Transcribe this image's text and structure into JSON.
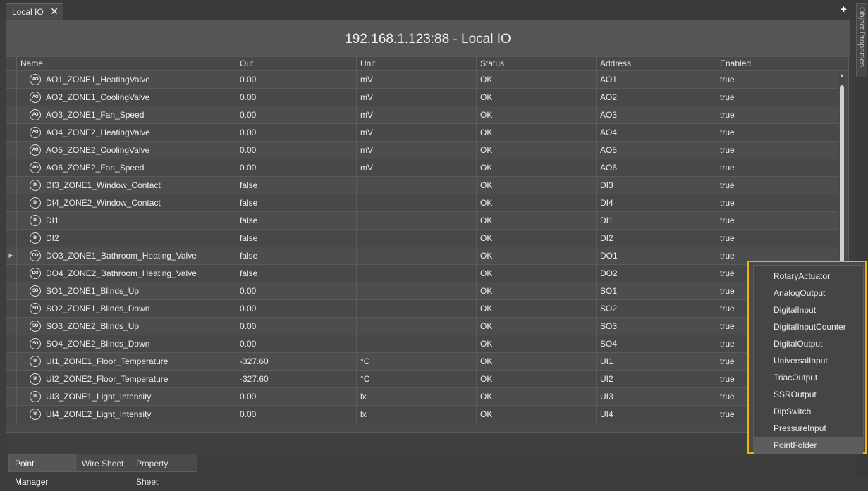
{
  "tabs": {
    "document_tab": "Local IO",
    "close_glyph": "✕",
    "add_glyph": "+"
  },
  "side_panel": {
    "label": "Object Properties"
  },
  "page_title": "192.168.1.123:88 - Local IO",
  "columns": [
    "Name",
    "Out",
    "Unit",
    "Status",
    "Address",
    "Enabled"
  ],
  "rows": [
    {
      "icon": "AO",
      "name": "AO1_ZONE1_HeatingValve",
      "out": "0.00",
      "unit": "mV",
      "status": "OK",
      "address": "AO1",
      "enabled": "true"
    },
    {
      "icon": "AO",
      "name": "AO2_ZONE1_CoolingValve",
      "out": "0.00",
      "unit": "mV",
      "status": "OK",
      "address": "AO2",
      "enabled": "true"
    },
    {
      "icon": "AO",
      "name": "AO3_ZONE1_Fan_Speed",
      "out": "0.00",
      "unit": "mV",
      "status": "OK",
      "address": "AO3",
      "enabled": "true"
    },
    {
      "icon": "AO",
      "name": "AO4_ZONE2_HeatingValve",
      "out": "0.00",
      "unit": "mV",
      "status": "OK",
      "address": "AO4",
      "enabled": "true"
    },
    {
      "icon": "AO",
      "name": "AO5_ZONE2_CoolingValve",
      "out": "0.00",
      "unit": "mV",
      "status": "OK",
      "address": "AO5",
      "enabled": "true"
    },
    {
      "icon": "AO",
      "name": "AO6_ZONE2_Fan_Speed",
      "out": "0.00",
      "unit": "mV",
      "status": "OK",
      "address": "AO6",
      "enabled": "true"
    },
    {
      "icon": "DI",
      "name": "DI3_ZONE1_Window_Contact",
      "out": "false",
      "unit": "",
      "status": "OK",
      "address": "DI3",
      "enabled": "true"
    },
    {
      "icon": "DI",
      "name": "DI4_ZONE2_Window_Contact",
      "out": "false",
      "unit": "",
      "status": "OK",
      "address": "DI4",
      "enabled": "true"
    },
    {
      "icon": "DI",
      "name": "DI1",
      "out": "false",
      "unit": "",
      "status": "OK",
      "address": "DI1",
      "enabled": "true"
    },
    {
      "icon": "DI",
      "name": "DI2",
      "out": "false",
      "unit": "",
      "status": "OK",
      "address": "DI2",
      "enabled": "true"
    },
    {
      "icon": "DO",
      "name": "DO3_ZONE1_Bathroom_Heating_Valve",
      "out": "false",
      "unit": "",
      "status": "OK",
      "address": "DO1",
      "enabled": "true",
      "expander": "▶"
    },
    {
      "icon": "DO",
      "name": "DO4_ZONE2_Bathroom_Heating_Valve",
      "out": "false",
      "unit": "",
      "status": "OK",
      "address": "DO2",
      "enabled": "true"
    },
    {
      "icon": "SO",
      "name": "SO1_ZONE1_Blinds_Up",
      "out": "0.00",
      "unit": "",
      "status": "OK",
      "address": "SO1",
      "enabled": "true"
    },
    {
      "icon": "SO",
      "name": "SO2_ZONE1_Blinds_Down",
      "out": "0.00",
      "unit": "",
      "status": "OK",
      "address": "SO2",
      "enabled": "true"
    },
    {
      "icon": "SO",
      "name": "SO3_ZONE2_Blinds_Up",
      "out": "0.00",
      "unit": "",
      "status": "OK",
      "address": "SO3",
      "enabled": "true"
    },
    {
      "icon": "SO",
      "name": "SO4_ZONE2_Blinds_Down",
      "out": "0.00",
      "unit": "",
      "status": "OK",
      "address": "SO4",
      "enabled": "true"
    },
    {
      "icon": "UI",
      "name": "UI1_ZONE1_Floor_Temperature",
      "out": "-327.60",
      "unit": "°C",
      "status": "OK",
      "address": "UI1",
      "enabled": "true"
    },
    {
      "icon": "UI",
      "name": "UI2_ZONE2_Floor_Temperature",
      "out": "-327.60",
      "unit": "°C",
      "status": "OK",
      "address": "UI2",
      "enabled": "true"
    },
    {
      "icon": "UI",
      "name": "UI3_ZONE1_Light_Intensity",
      "out": "0.00",
      "unit": "lx",
      "status": "OK",
      "address": "UI3",
      "enabled": "true"
    },
    {
      "icon": "UI",
      "name": "UI4_ZONE2_Light_Intensity",
      "out": "0.00",
      "unit": "lx",
      "status": "OK",
      "address": "UI4",
      "enabled": "true"
    }
  ],
  "bottom_tabs": [
    "Point Manager",
    "Wire Sheet",
    "Property Sheet"
  ],
  "context_menu": {
    "items": [
      "RotaryActuator",
      "AnalogOutput",
      "DigitalInput",
      "DigitalInputCounter",
      "DigitalOutput",
      "UniversalInput",
      "TriacOutput",
      "SSROutput",
      "DipSwitch",
      "PressureInput",
      "PointFolder"
    ],
    "highlighted": "PointFolder",
    "border_color": "#f0b400"
  },
  "scrollbar": {
    "up_glyph": "▲"
  }
}
